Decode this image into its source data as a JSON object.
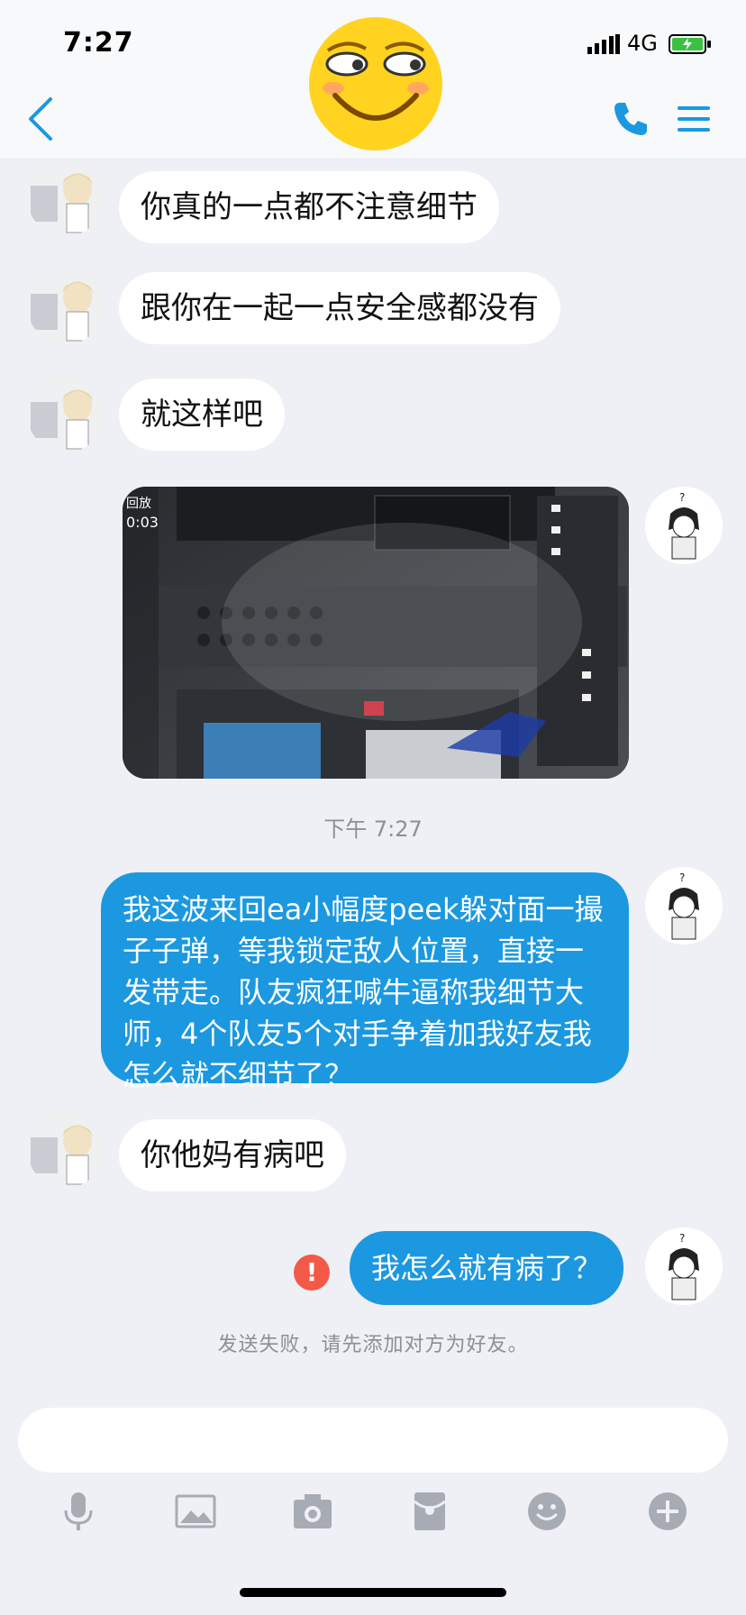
{
  "status_bar": {
    "time": "7:27",
    "network": "4G"
  },
  "colors": {
    "accent": "#1b98e0",
    "error": "#f25a47",
    "background": "#eef0f5"
  },
  "header": {
    "back_icon": "chevron-left-icon",
    "call_icon": "phone-icon",
    "menu_icon": "hamburger-menu-icon"
  },
  "messages": [
    {
      "from": "contact",
      "text": "你真的一点都不注意细节"
    },
    {
      "from": "contact",
      "text": "跟你在一起一点安全感都没有"
    },
    {
      "from": "contact",
      "text": "就这样吧"
    },
    {
      "from": "me",
      "type": "image",
      "overlay": {
        "line1": "回放",
        "line2": "0:03"
      }
    },
    {
      "type": "timestamp",
      "text": "下午 7:27"
    },
    {
      "from": "me",
      "text": "我这波来回ea小幅度peek躲对面一撮子子弹，等我锁定敌人位置，直接一发带走。队友疯狂喊牛逼称我细节大师，4个队友5个对手争着加我好友我怎么就不细节了？"
    },
    {
      "from": "contact",
      "text": "你他妈有病吧"
    },
    {
      "from": "me",
      "text": "我怎么就有病了？",
      "status": "failed"
    },
    {
      "type": "system",
      "text": "发送失败，请先添加对方为好友。"
    }
  ],
  "toolbar": [
    "microphone-icon",
    "image-icon",
    "camera-icon",
    "red-packet-icon",
    "emoji-icon",
    "plus-icon"
  ]
}
